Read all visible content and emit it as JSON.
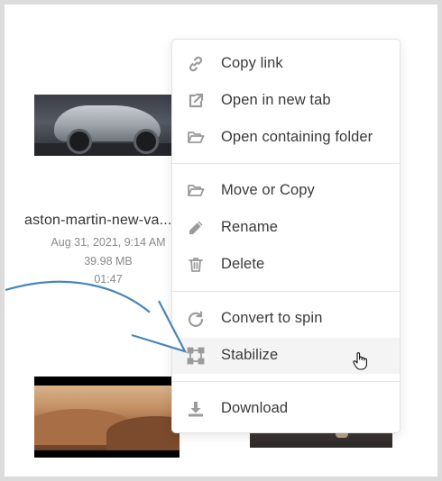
{
  "files": [
    {
      "name": "aston-martin-new-va...",
      "date": "Aug 31, 2021, 9:14 AM",
      "size": "39.98 MB",
      "duration": "01:47"
    }
  ],
  "menu": {
    "items": [
      {
        "label": "Copy link",
        "icon": "link-icon"
      },
      {
        "label": "Open in new tab",
        "icon": "external-link-icon"
      },
      {
        "label": "Open containing folder",
        "icon": "folder-open-icon"
      },
      {
        "label": "Move or Copy",
        "icon": "folder-open-icon"
      },
      {
        "label": "Rename",
        "icon": "pencil-icon"
      },
      {
        "label": "Delete",
        "icon": "trash-icon"
      },
      {
        "label": "Convert to spin",
        "icon": "rotate-icon"
      },
      {
        "label": "Stabilize",
        "icon": "bounding-box-icon",
        "hovered": true
      },
      {
        "label": "Download",
        "icon": "download-icon"
      }
    ]
  },
  "colors": {
    "icon": "#9b9b9b",
    "text": "#3a3a3a",
    "meta_text": "#8a8a8a",
    "arrow": "#4a86b8",
    "hover_bg": "#f4f4f4",
    "frame_border": "#dcdcdc"
  }
}
